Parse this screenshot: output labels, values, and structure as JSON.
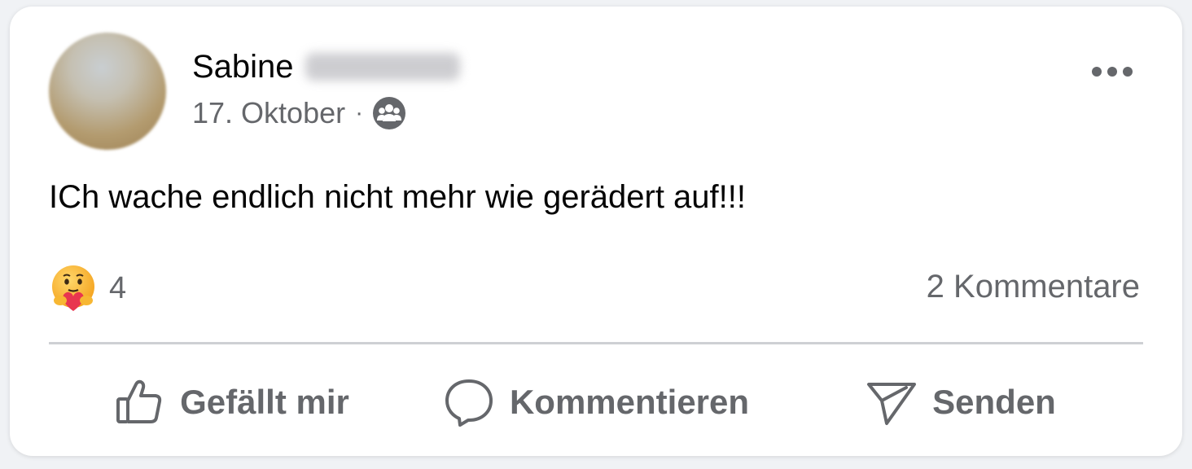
{
  "post": {
    "author_first_name": "Sabine",
    "date": "17. Oktober",
    "separator": "·",
    "audience_icon": "group-icon",
    "text": "ICh wache endlich nicht mehr wie gerädert auf!!!"
  },
  "reactions": {
    "icon": "care-reaction-icon",
    "count": "4"
  },
  "comments": {
    "label": "2 Kommentare"
  },
  "actions": {
    "like_label": "Gefällt mir",
    "comment_label": "Kommentieren",
    "send_label": "Senden"
  },
  "colors": {
    "text_primary": "#050505",
    "text_secondary": "#65676b",
    "divider": "#ced0d4",
    "card_bg": "#ffffff"
  }
}
